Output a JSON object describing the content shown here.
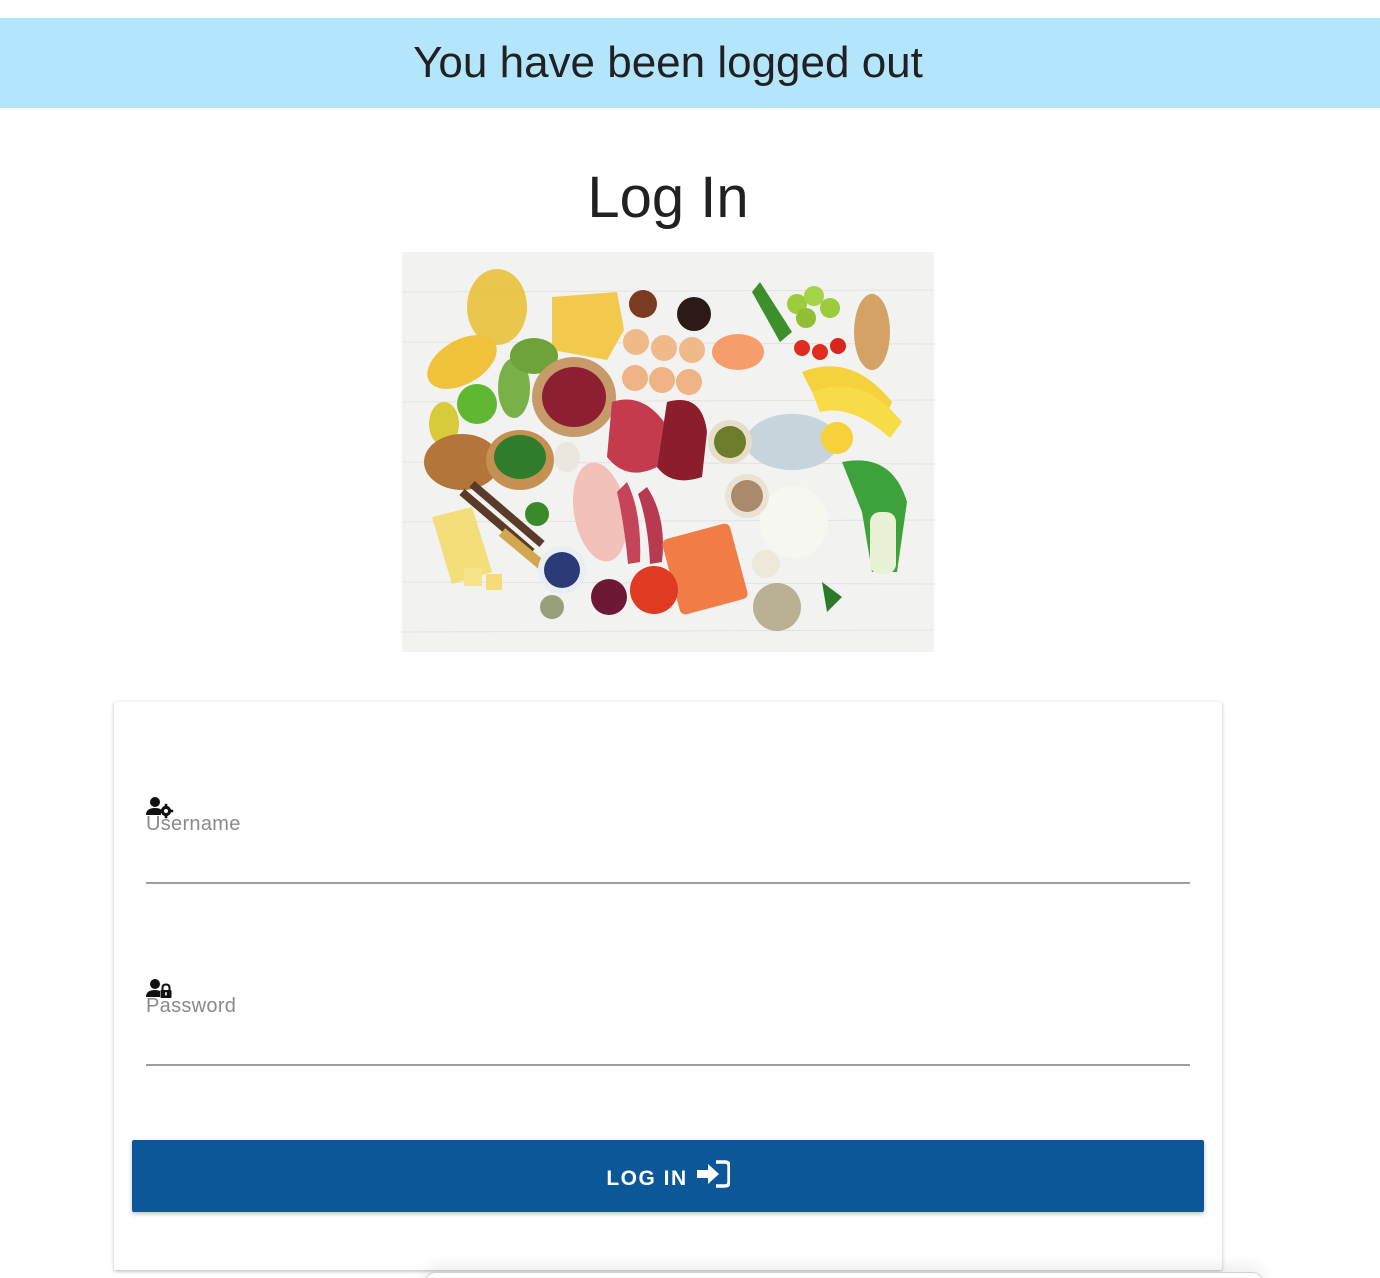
{
  "flash": {
    "message": "You have been logged out",
    "background": "#b3e5fc"
  },
  "page": {
    "title": "Log In"
  },
  "hero_image": {
    "icon": "food-assortment-image"
  },
  "form": {
    "username": {
      "label": "Username",
      "value": "",
      "icon": "user-gear-icon"
    },
    "password": {
      "label": "Password",
      "value": "",
      "icon": "user-lock-icon"
    },
    "submit": {
      "label": "LOG IN",
      "icon": "sign-in-icon",
      "color": "#0c5797"
    }
  }
}
